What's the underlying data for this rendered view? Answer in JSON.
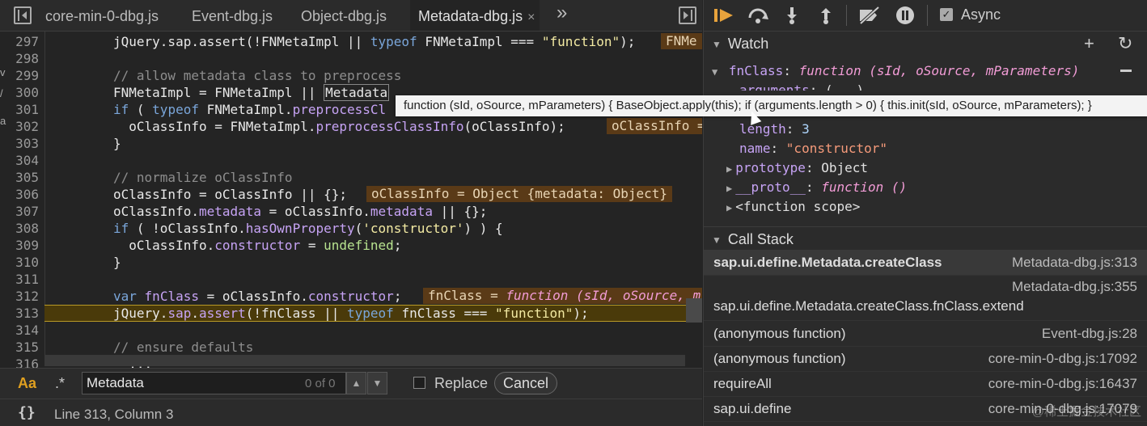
{
  "tabs": [
    {
      "label": "core-min-0-dbg.js"
    },
    {
      "label": "Event-dbg.js"
    },
    {
      "label": "Object-dbg.js"
    },
    {
      "label": "Metadata-dbg.js",
      "active": true
    }
  ],
  "tab_close": "×",
  "tab_more": "»",
  "code_lines": [
    {
      "n": "297"
    },
    {
      "n": "298"
    },
    {
      "n": "299"
    },
    {
      "n": "300"
    },
    {
      "n": "301"
    },
    {
      "n": "302"
    },
    {
      "n": "303"
    },
    {
      "n": "304"
    },
    {
      "n": "305"
    },
    {
      "n": "306"
    },
    {
      "n": "307"
    },
    {
      "n": "308"
    },
    {
      "n": "309"
    },
    {
      "n": "310"
    },
    {
      "n": "311"
    },
    {
      "n": "312"
    },
    {
      "n": "313"
    },
    {
      "n": "314"
    },
    {
      "n": "315"
    },
    {
      "n": "316"
    }
  ],
  "code": {
    "l297a": "jQuery.sap.assert(!FNMetaImpl || ",
    "l297k": "typeof",
    "l297b": " FNMetaImpl === ",
    "l297s": "\"function\"",
    "l297c": ");",
    "l297inl": "FNMe",
    "l299": "// allow metadata class to preprocess",
    "l300a": "FNMetaImpl = FNMetaImpl || ",
    "l300m": "Metadata",
    "l301k1": "if",
    "l301a": " ( ",
    "l301k2": "typeof",
    "l301b": " FNMetaImpl.",
    "l301p": "preprocessCl",
    "l302a": "  oClassInfo = FNMetaImpl.",
    "l302p": "preprocessClassInfo",
    "l302b": "(oClassInfo);",
    "l302inl": "oClassInfo =",
    "l303": "}",
    "l305": "// normalize oClassInfo",
    "l306": "oClassInfo = oClassInfo || {};",
    "l306inl": "oClassInfo = Object {metadata: Object}",
    "l307a": "oClassInfo.",
    "l307p1": "metadata",
    "l307b": " = oClassInfo.",
    "l307p2": "metadata",
    "l307c": " || {};",
    "l308k": "if",
    "l308a": " ( !oClassInfo.",
    "l308p": "hasOwnProperty",
    "l308b": "(",
    "l308s": "'constructor'",
    "l308c": ") ) {",
    "l309a": "  oClassInfo.",
    "l309p": "constructor",
    "l309b": " = ",
    "l309u": "undefined",
    "l309c": ";",
    "l310": "}",
    "l312k": "var",
    "l312a": " ",
    "l312p1": "fnClass",
    "l312b": " = oClassInfo.",
    "l312p2": "constructor",
    "l312c": ";",
    "l312inl_a": "fnClass = ",
    "l312inl_f": "function (sId, oSource, m",
    "l313a": "jQuery.",
    "l313p1": "sap",
    "l313b": ".",
    "l313p2": "assert",
    "l313c": "(!fnClass || ",
    "l313k": "typeof",
    "l313d": " fnClass === ",
    "l313s": "\"function\"",
    "l313e": ");",
    "l315": "// ensure defaults",
    "l316": "  ..."
  },
  "tooltip": "function (sId, oSource, mParameters) { BaseObject.apply(this); if (arguments.length > 0) { this.init(sId, oSource, mParameters); }",
  "search": {
    "case_label": "Aa",
    "regex_label": ".*",
    "value": "Metadata",
    "count": "0 of 0",
    "up": "▲",
    "down": "▼",
    "replace_label": "Replace",
    "cancel_label": "Cancel"
  },
  "status": {
    "format_label": "{}",
    "position": "Line 313, Column 3"
  },
  "debugger": {
    "async_label": "Async",
    "async_check": "✓",
    "watch_title": "Watch",
    "watch_add": "+",
    "watch_refresh": "↻",
    "callstack_title": "Call Stack"
  },
  "watch": {
    "expr_name": "fnClass",
    "expr_sep": ": ",
    "expr_fn": "function (sId, oSource, mParameters)",
    "arguments_name": "arguments",
    "arguments_val": ": (...)",
    "length_name": "length",
    "length_val": "3",
    "name_name": "name",
    "name_val": "\"constructor\"",
    "prototype_name": "prototype",
    "prototype_val": "Object",
    "proto_name": "__proto__",
    "proto_val": "function ()",
    "scope_label": "<function scope>"
  },
  "call_stack": [
    {
      "fn": "sap.ui.define.Metadata.createClass",
      "loc": "Metadata-dbg.js:313",
      "selected": true
    },
    {
      "fn": "sap.ui.define.Metadata.createClass.fnClass.extend",
      "loc": "Metadata-dbg.js:355"
    },
    {
      "fn": "(anonymous function)",
      "loc": "Event-dbg.js:28"
    },
    {
      "fn": "(anonymous function)",
      "loc": "core-min-0-dbg.js:17092"
    },
    {
      "fn": "requireAll",
      "loc": "core-min-0-dbg.js:16437"
    },
    {
      "fn": "sap.ui.define",
      "loc": "core-min-0-dbg.js:17079"
    }
  ],
  "watermark": "@稀土掘金技术社区",
  "edge_glyphs": [
    "v",
    "/",
    "a"
  ],
  "colors": {
    "keyword": "#7aa6da",
    "property": "#c6a3f4",
    "string": "#f3eaa3",
    "comment": "#8d8d8d",
    "exec_line": "#4a3a0a",
    "inline_value": "#5a3a17"
  }
}
